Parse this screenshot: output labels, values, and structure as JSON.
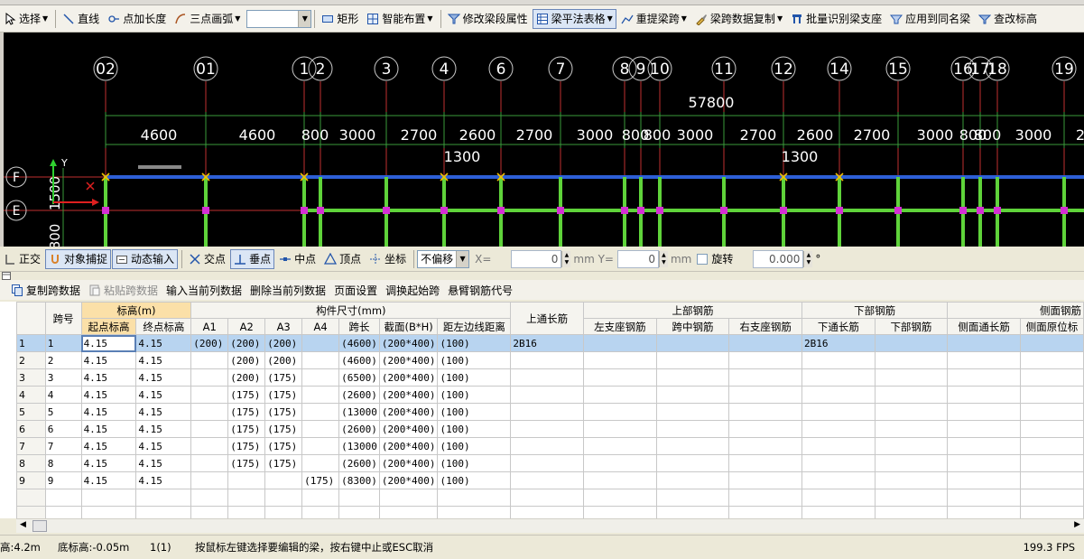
{
  "toolbar_main": {
    "select": "选择",
    "line": "直线",
    "point_length": "点加长度",
    "arc": "三点画弧",
    "rect": "矩形",
    "smart_layout": "智能布置",
    "modify_beam_attr": "修改梁段属性",
    "beam_table": "梁平法表格",
    "re_extract_span": "重提梁跨",
    "span_copy": "梁跨数据复制",
    "batch_identify": "批量识别梁支座",
    "apply_same_name": "应用到同名梁",
    "check_elevation": "查改标高"
  },
  "drawing": {
    "axes": [
      "02",
      "01",
      "1",
      "2",
      "3",
      "4",
      "6",
      "7",
      "8",
      "9",
      "10",
      "11",
      "12",
      "14",
      "15",
      "16",
      "17",
      "18",
      "19"
    ],
    "total_dim": "57800",
    "dims": [
      "4600",
      "4600",
      "800",
      "3000",
      "2700",
      "2600",
      "2700",
      "3000",
      "800",
      "800",
      "3000",
      "2700",
      "2600",
      "2700",
      "3000",
      "800",
      "800",
      "3000",
      "2"
    ],
    "sub_dims": [
      "1300",
      "1300"
    ],
    "row_axes": [
      "F",
      "E"
    ],
    "left_dims": [
      "1500",
      "800"
    ],
    "ucs_label": "Y"
  },
  "toolbar_snap": {
    "ortho": "正交",
    "snap": "对象捕捉",
    "dynamic_input": "动态输入",
    "intersection": "交点",
    "perpendicular": "垂点",
    "midpoint": "中点",
    "vertex": "顶点",
    "coordinate": "坐标",
    "offset_mode": "不偏移",
    "x_label": "X=",
    "x_value": "0",
    "y_label": "mm Y=",
    "y_value": "0",
    "unit": "mm",
    "rotate_label": "旋转",
    "rotate_value": "0.000",
    "degree": "°"
  },
  "toolbar_table": {
    "copy_span": "复制跨数据",
    "paste_span": "粘贴跨数据",
    "input_col": "输入当前列数据",
    "delete_col": "删除当前列数据",
    "page_setup": "页面设置",
    "swap_start": "调换起始跨",
    "cantilever": "悬臂钢筋代号"
  },
  "table": {
    "group_headers": {
      "elevation": "标高(m)",
      "dimension": "构件尺寸(mm)",
      "top_through": "上通长筋",
      "top_rebar": "上部钢筋",
      "bottom_rebar": "下部钢筋",
      "side_rebar": "侧面钢筋"
    },
    "columns": {
      "span_no": "跨号",
      "start_elev": "起点标高",
      "end_elev": "终点标高",
      "a1": "A1",
      "a2": "A2",
      "a3": "A3",
      "a4": "A4",
      "span_len": "跨长",
      "section": "截面(B*H)",
      "left_dist": "距左边线距离",
      "left_support": "左支座钢筋",
      "mid_span": "跨中钢筋",
      "right_support": "右支座钢筋",
      "bottom_through": "下通长筋",
      "bottom": "下部钢筋",
      "side_through": "侧面通长筋",
      "side_local": "侧面原位标"
    },
    "rows": [
      [
        "1",
        "1",
        "4.15",
        "4.15",
        "(200)",
        "(200)",
        "(200)",
        "",
        "(4600)",
        "(200*400)",
        "(100)",
        "2B16",
        "",
        "",
        "",
        "2B16",
        "",
        "",
        ""
      ],
      [
        "2",
        "2",
        "4.15",
        "4.15",
        "",
        "(200)",
        "(200)",
        "",
        "(4600)",
        "(200*400)",
        "(100)",
        "",
        "",
        "",
        "",
        "",
        "",
        "",
        ""
      ],
      [
        "3",
        "3",
        "4.15",
        "4.15",
        "",
        "(200)",
        "(175)",
        "",
        "(6500)",
        "(200*400)",
        "(100)",
        "",
        "",
        "",
        "",
        "",
        "",
        "",
        ""
      ],
      [
        "4",
        "4",
        "4.15",
        "4.15",
        "",
        "(175)",
        "(175)",
        "",
        "(2600)",
        "(200*400)",
        "(100)",
        "",
        "",
        "",
        "",
        "",
        "",
        "",
        ""
      ],
      [
        "5",
        "5",
        "4.15",
        "4.15",
        "",
        "(175)",
        "(175)",
        "",
        "(13000",
        "(200*400)",
        "(100)",
        "",
        "",
        "",
        "",
        "",
        "",
        "",
        ""
      ],
      [
        "6",
        "6",
        "4.15",
        "4.15",
        "",
        "(175)",
        "(175)",
        "",
        "(2600)",
        "(200*400)",
        "(100)",
        "",
        "",
        "",
        "",
        "",
        "",
        "",
        ""
      ],
      [
        "7",
        "7",
        "4.15",
        "4.15",
        "",
        "(175)",
        "(175)",
        "",
        "(13000",
        "(200*400)",
        "(100)",
        "",
        "",
        "",
        "",
        "",
        "",
        "",
        ""
      ],
      [
        "8",
        "8",
        "4.15",
        "4.15",
        "",
        "(175)",
        "(175)",
        "",
        "(2600)",
        "(200*400)",
        "(100)",
        "",
        "",
        "",
        "",
        "",
        "",
        "",
        ""
      ],
      [
        "9",
        "9",
        "4.15",
        "4.15",
        "",
        "",
        "",
        "(175)",
        "(8300)",
        "(200*400)",
        "(100)",
        "",
        "",
        "",
        "",
        "",
        "",
        "",
        ""
      ]
    ]
  },
  "status": {
    "top_elev": "高:4.2m",
    "bottom_elev": "底标高:-0.05m",
    "count": "1(1)",
    "hint": "按鼠标左键选择要编辑的梁，按右键中止或ESC取消",
    "fps": "199.3 FPS"
  }
}
